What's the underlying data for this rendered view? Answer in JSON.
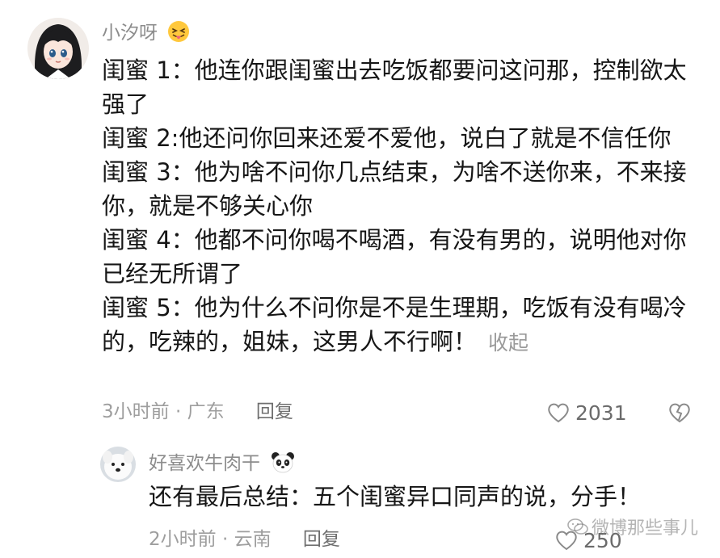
{
  "main_comment": {
    "username": "小汐呀",
    "username_emoji": "grinning-tongue-emoji",
    "paragraphs": [
      "闺蜜 1：他连你跟闺蜜出去吃饭都要问这问那，控制欲太强了",
      "闺蜜 2:他还问你回来还爱不爱他，说白了就是不信任你",
      "闺蜜 3：他为啥不问你几点结束，为啥不送你来，不来接你，就是不够关心你",
      "闺蜜 4：他都不问你喝不喝酒，有没有男的，说明他对你已经无所谓了",
      "闺蜜 5：他为什么不问你是不是生理期，吃饭有没有喝冷的，吃辣的，姐妹，这男人不行啊！"
    ],
    "collapse_label": "收起",
    "time_location": "3小时前 · 广东",
    "reply_label": "回复",
    "like_count": "2031"
  },
  "reply_comment": {
    "username": "好喜欢牛肉干",
    "username_emoji": "panda-emoji",
    "text": "还有最后总结：五个闺蜜异口同声的说，分手！",
    "time_location": "2小时前 · 云南",
    "reply_label": "回复",
    "like_count": "250"
  },
  "watermark": {
    "text": "微博那些事儿"
  },
  "colors": {
    "text_primary": "#161616",
    "text_secondary": "#9e9e9e",
    "username": "#8c8c8c",
    "background": "#ffffff"
  }
}
